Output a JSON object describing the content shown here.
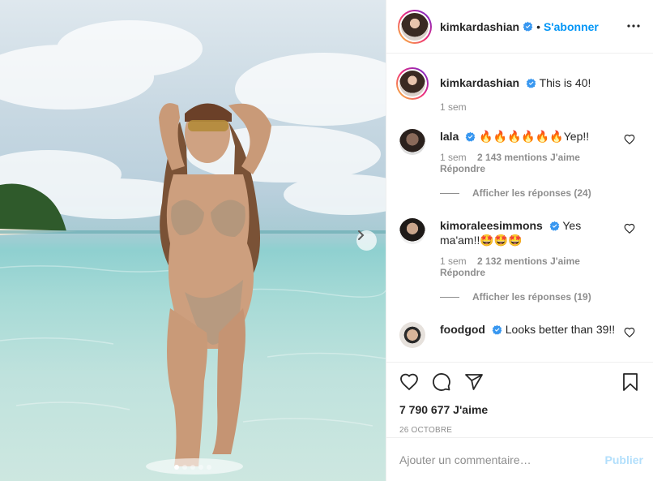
{
  "header": {
    "username": "kimkardashian",
    "separator": "•",
    "follow_label": "S'abonner"
  },
  "caption": {
    "username": "kimkardashian",
    "text": "This is 40!",
    "time": "1 sem"
  },
  "comments": [
    {
      "username": "lala",
      "text": "🔥🔥🔥🔥🔥🔥Yep!!",
      "time": "1 sem",
      "likes": "2 143 mentions J'aime",
      "reply": "Répondre",
      "view_replies": "Afficher les réponses (24)"
    },
    {
      "username": "kimoraleesimmons",
      "text": "Yes ma'am!!🤩🤩🤩",
      "time": "1 sem",
      "likes": "2 132 mentions J'aime",
      "reply": "Répondre",
      "view_replies": "Afficher les réponses (19)"
    },
    {
      "username": "foodgod",
      "text": "Looks better than 39!!"
    }
  ],
  "post": {
    "likes_count": "7 790 677 J'aime",
    "date": "26 OCTOBRE"
  },
  "add_comment": {
    "placeholder": "Ajouter un commentaire…",
    "publish_label": "Publier"
  },
  "carousel": {
    "total": 5,
    "active": 0
  },
  "colors": {
    "accent": "#0095f6",
    "publish_disabled": "#b2dffc",
    "muted": "#8e8e8e",
    "text": "#262626"
  }
}
